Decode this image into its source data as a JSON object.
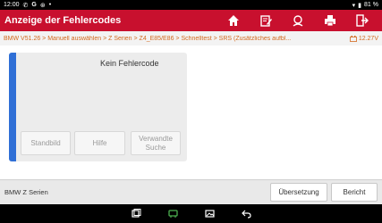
{
  "status": {
    "time": "12:00",
    "battery": "81 %"
  },
  "titlebar": {
    "title": "Anzeige der Fehlercodes",
    "buttons": [
      "home-icon",
      "report-edit-icon",
      "support-icon",
      "print-icon",
      "exit-icon"
    ]
  },
  "breadcrumb": {
    "path": "BMW V51.26 > Manuell auswählen > Z Serien > Z4_E85/E86 > Schnelltest > SRS (Zusätzliches aufbl...",
    "voltage": "12.27V"
  },
  "card": {
    "message": "Kein Fehlercode",
    "buttons": {
      "freeze": "Standbild",
      "help": "Hilfe",
      "related_line1": "Verwandte",
      "related_line2": "Suche"
    }
  },
  "bottom": {
    "model": "BMW Z Serien",
    "translate": "Übersetzung",
    "report": "Bericht"
  },
  "colors": {
    "header": "#c8102e",
    "accent": "#2f6fd6",
    "breadcrumb": "#d2691e"
  }
}
